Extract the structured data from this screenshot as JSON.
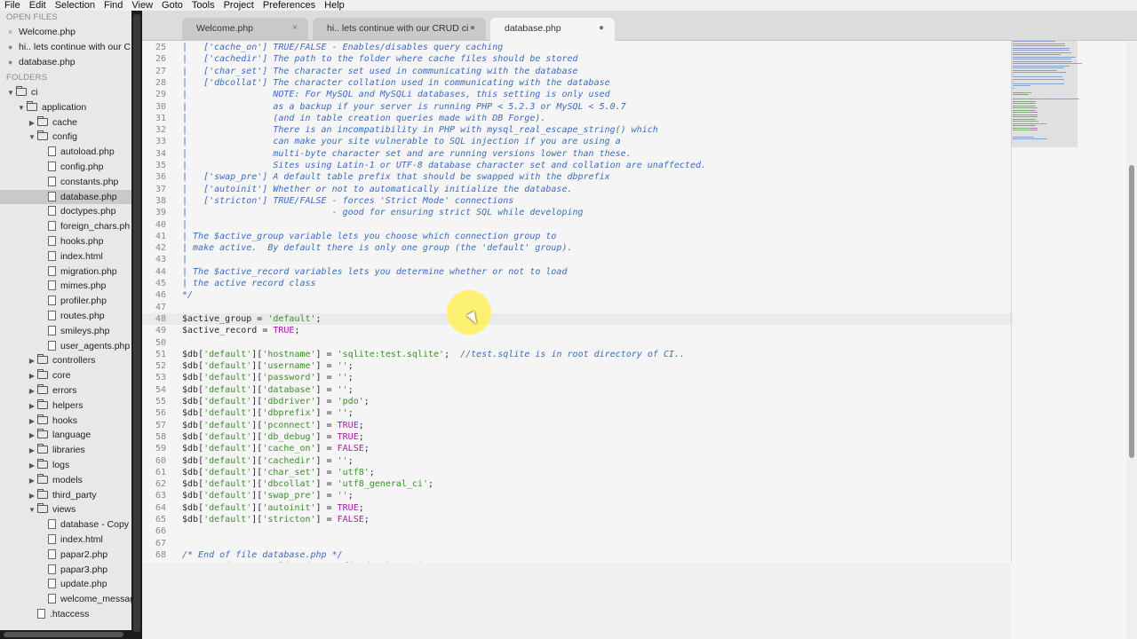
{
  "menu": [
    "File",
    "Edit",
    "Selection",
    "Find",
    "View",
    "Goto",
    "Tools",
    "Project",
    "Preferences",
    "Help"
  ],
  "sidebar": {
    "open_files_header": "OPEN FILES",
    "open_files": [
      {
        "label": "Welcome.php",
        "mark": "×"
      },
      {
        "label": "hi.. lets continue with our C",
        "mark": "●"
      },
      {
        "label": "database.php",
        "mark": "●"
      }
    ],
    "folders_header": "FOLDERS",
    "tree": [
      {
        "label": "ci",
        "type": "folder",
        "depth": 0,
        "state": "open"
      },
      {
        "label": "application",
        "type": "folder",
        "depth": 1,
        "state": "open"
      },
      {
        "label": "cache",
        "type": "folder",
        "depth": 2,
        "state": "closed"
      },
      {
        "label": "config",
        "type": "folder",
        "depth": 2,
        "state": "open"
      },
      {
        "label": "autoload.php",
        "type": "file",
        "depth": 3
      },
      {
        "label": "config.php",
        "type": "file",
        "depth": 3
      },
      {
        "label": "constants.php",
        "type": "file",
        "depth": 3
      },
      {
        "label": "database.php",
        "type": "file",
        "depth": 3,
        "selected": true
      },
      {
        "label": "doctypes.php",
        "type": "file",
        "depth": 3
      },
      {
        "label": "foreign_chars.ph",
        "type": "file",
        "depth": 3
      },
      {
        "label": "hooks.php",
        "type": "file",
        "depth": 3
      },
      {
        "label": "index.html",
        "type": "file",
        "depth": 3
      },
      {
        "label": "migration.php",
        "type": "file",
        "depth": 3
      },
      {
        "label": "mimes.php",
        "type": "file",
        "depth": 3
      },
      {
        "label": "profiler.php",
        "type": "file",
        "depth": 3
      },
      {
        "label": "routes.php",
        "type": "file",
        "depth": 3
      },
      {
        "label": "smileys.php",
        "type": "file",
        "depth": 3
      },
      {
        "label": "user_agents.php",
        "type": "file",
        "depth": 3
      },
      {
        "label": "controllers",
        "type": "folder",
        "depth": 2,
        "state": "closed"
      },
      {
        "label": "core",
        "type": "folder",
        "depth": 2,
        "state": "closed"
      },
      {
        "label": "errors",
        "type": "folder",
        "depth": 2,
        "state": "closed"
      },
      {
        "label": "helpers",
        "type": "folder",
        "depth": 2,
        "state": "closed"
      },
      {
        "label": "hooks",
        "type": "folder",
        "depth": 2,
        "state": "closed"
      },
      {
        "label": "language",
        "type": "folder",
        "depth": 2,
        "state": "closed"
      },
      {
        "label": "libraries",
        "type": "folder",
        "depth": 2,
        "state": "closed"
      },
      {
        "label": "logs",
        "type": "folder",
        "depth": 2,
        "state": "closed"
      },
      {
        "label": "models",
        "type": "folder",
        "depth": 2,
        "state": "closed"
      },
      {
        "label": "third_party",
        "type": "folder",
        "depth": 2,
        "state": "closed"
      },
      {
        "label": "views",
        "type": "folder",
        "depth": 2,
        "state": "open"
      },
      {
        "label": "database - Copy",
        "type": "file",
        "depth": 3
      },
      {
        "label": "index.html",
        "type": "file",
        "depth": 3
      },
      {
        "label": "papar2.php",
        "type": "file",
        "depth": 3
      },
      {
        "label": "papar3.php",
        "type": "file",
        "depth": 3
      },
      {
        "label": "update.php",
        "type": "file",
        "depth": 3
      },
      {
        "label": "welcome_messag",
        "type": "file",
        "depth": 3
      },
      {
        "label": ".htaccess",
        "type": "file",
        "depth": 2
      }
    ]
  },
  "tabs": [
    {
      "label": "Welcome.php",
      "mark": "×",
      "active": false
    },
    {
      "label": "hi.. lets continue with our CRUD ci",
      "mark": "●",
      "active": false
    },
    {
      "label": "database.php",
      "mark": "●",
      "active": true
    }
  ],
  "editor": {
    "first_line": 25,
    "highlighted_line": 48,
    "lines": [
      [
        [
          "cm",
          "|   ['cache_on'] TRUE/FALSE - Enables/disables query caching"
        ]
      ],
      [
        [
          "cm",
          "|   ['cachedir'] The path to the folder where cache files should be stored"
        ]
      ],
      [
        [
          "cm",
          "|   ['char_set'] The character set used in communicating with the database"
        ]
      ],
      [
        [
          "cm",
          "|   ['dbcollat'] The character collation used in communicating with the database"
        ]
      ],
      [
        [
          "cm",
          "|                NOTE: For MySQL and MySQLi databases, this setting is only used"
        ]
      ],
      [
        [
          "cm",
          "|                as a backup if your server is running PHP < 5.2.3 or MySQL < 5.0.7"
        ]
      ],
      [
        [
          "cm",
          "|                (and in table creation queries made with DB Forge)."
        ]
      ],
      [
        [
          "cm",
          "|                There is an incompatibility in PHP with mysql_real_escape_string() which"
        ]
      ],
      [
        [
          "cm",
          "|                can make your site vulnerable to SQL injection if you are using a"
        ]
      ],
      [
        [
          "cm",
          "|                multi-byte character set and are running versions lower than these."
        ]
      ],
      [
        [
          "cm",
          "|                Sites using Latin-1 or UTF-8 database character set and collation are unaffected."
        ]
      ],
      [
        [
          "cm",
          "|   ['swap_pre'] A default table prefix that should be swapped with the dbprefix"
        ]
      ],
      [
        [
          "cm",
          "|   ['autoinit'] Whether or not to automatically initialize the database."
        ]
      ],
      [
        [
          "cm",
          "|   ['stricton'] TRUE/FALSE - forces 'Strict Mode' connections"
        ]
      ],
      [
        [
          "cm",
          "|                           - good for ensuring strict SQL while developing"
        ]
      ],
      [
        [
          "cm",
          "|"
        ]
      ],
      [
        [
          "cm",
          "| The $active_group variable lets you choose which connection group to"
        ]
      ],
      [
        [
          "cm",
          "| make active.  By default there is only one group (the 'default' group)."
        ]
      ],
      [
        [
          "cm",
          "|"
        ]
      ],
      [
        [
          "cm",
          "| The $active_record variables lets you determine whether or not to load"
        ]
      ],
      [
        [
          "cm",
          "| the active record class"
        ]
      ],
      [
        [
          "cm",
          "*/"
        ]
      ],
      [
        [
          "op",
          ""
        ]
      ],
      [
        [
          "vr",
          "$active_group"
        ],
        [
          "op",
          " = "
        ],
        [
          "st",
          "'default'"
        ],
        [
          "op",
          ";"
        ]
      ],
      [
        [
          "vr",
          "$active_record"
        ],
        [
          "op",
          " = "
        ],
        [
          "kw",
          "TRUE"
        ],
        [
          "op",
          ";"
        ]
      ],
      [
        [
          "op",
          ""
        ]
      ],
      [
        [
          "vr",
          "$db"
        ],
        [
          "op",
          "["
        ],
        [
          "st",
          "'default'"
        ],
        [
          "op",
          "]["
        ],
        [
          "st",
          "'hostname'"
        ],
        [
          "op",
          "] = "
        ],
        [
          "st",
          "'sqlite:test.sqlite'"
        ],
        [
          "op",
          ";  "
        ],
        [
          "cm",
          "//test.sqlite is in root directory of CI.."
        ]
      ],
      [
        [
          "vr",
          "$db"
        ],
        [
          "op",
          "["
        ],
        [
          "st",
          "'default'"
        ],
        [
          "op",
          "]["
        ],
        [
          "st",
          "'username'"
        ],
        [
          "op",
          "] = "
        ],
        [
          "st",
          "''"
        ],
        [
          "op",
          ";"
        ]
      ],
      [
        [
          "vr",
          "$db"
        ],
        [
          "op",
          "["
        ],
        [
          "st",
          "'default'"
        ],
        [
          "op",
          "]["
        ],
        [
          "st",
          "'password'"
        ],
        [
          "op",
          "] = "
        ],
        [
          "st",
          "''"
        ],
        [
          "op",
          ";"
        ]
      ],
      [
        [
          "vr",
          "$db"
        ],
        [
          "op",
          "["
        ],
        [
          "st",
          "'default'"
        ],
        [
          "op",
          "]["
        ],
        [
          "st",
          "'database'"
        ],
        [
          "op",
          "] = "
        ],
        [
          "st",
          "''"
        ],
        [
          "op",
          ";"
        ]
      ],
      [
        [
          "vr",
          "$db"
        ],
        [
          "op",
          "["
        ],
        [
          "st",
          "'default'"
        ],
        [
          "op",
          "]["
        ],
        [
          "st",
          "'dbdriver'"
        ],
        [
          "op",
          "] = "
        ],
        [
          "st",
          "'pdo'"
        ],
        [
          "op",
          ";"
        ]
      ],
      [
        [
          "vr",
          "$db"
        ],
        [
          "op",
          "["
        ],
        [
          "st",
          "'default'"
        ],
        [
          "op",
          "]["
        ],
        [
          "st",
          "'dbprefix'"
        ],
        [
          "op",
          "] = "
        ],
        [
          "st",
          "''"
        ],
        [
          "op",
          ";"
        ]
      ],
      [
        [
          "vr",
          "$db"
        ],
        [
          "op",
          "["
        ],
        [
          "st",
          "'default'"
        ],
        [
          "op",
          "]["
        ],
        [
          "st",
          "'pconnect'"
        ],
        [
          "op",
          "] = "
        ],
        [
          "kw",
          "TRUE"
        ],
        [
          "op",
          ";"
        ]
      ],
      [
        [
          "vr",
          "$db"
        ],
        [
          "op",
          "["
        ],
        [
          "st",
          "'default'"
        ],
        [
          "op",
          "]["
        ],
        [
          "st",
          "'db_debug'"
        ],
        [
          "op",
          "] = "
        ],
        [
          "kw",
          "TRUE"
        ],
        [
          "op",
          ";"
        ]
      ],
      [
        [
          "vr",
          "$db"
        ],
        [
          "op",
          "["
        ],
        [
          "st",
          "'default'"
        ],
        [
          "op",
          "]["
        ],
        [
          "st",
          "'cache_on'"
        ],
        [
          "op",
          "] = "
        ],
        [
          "kw",
          "FALSE"
        ],
        [
          "op",
          ";"
        ]
      ],
      [
        [
          "vr",
          "$db"
        ],
        [
          "op",
          "["
        ],
        [
          "st",
          "'default'"
        ],
        [
          "op",
          "]["
        ],
        [
          "st",
          "'cachedir'"
        ],
        [
          "op",
          "] = "
        ],
        [
          "st",
          "''"
        ],
        [
          "op",
          ";"
        ]
      ],
      [
        [
          "vr",
          "$db"
        ],
        [
          "op",
          "["
        ],
        [
          "st",
          "'default'"
        ],
        [
          "op",
          "]["
        ],
        [
          "st",
          "'char_set'"
        ],
        [
          "op",
          "] = "
        ],
        [
          "st",
          "'utf8'"
        ],
        [
          "op",
          ";"
        ]
      ],
      [
        [
          "vr",
          "$db"
        ],
        [
          "op",
          "["
        ],
        [
          "st",
          "'default'"
        ],
        [
          "op",
          "]["
        ],
        [
          "st",
          "'dbcollat'"
        ],
        [
          "op",
          "] = "
        ],
        [
          "st",
          "'utf8_general_ci'"
        ],
        [
          "op",
          ";"
        ]
      ],
      [
        [
          "vr",
          "$db"
        ],
        [
          "op",
          "["
        ],
        [
          "st",
          "'default'"
        ],
        [
          "op",
          "]["
        ],
        [
          "st",
          "'swap_pre'"
        ],
        [
          "op",
          "] = "
        ],
        [
          "st",
          "''"
        ],
        [
          "op",
          ";"
        ]
      ],
      [
        [
          "vr",
          "$db"
        ],
        [
          "op",
          "["
        ],
        [
          "st",
          "'default'"
        ],
        [
          "op",
          "]["
        ],
        [
          "st",
          "'autoinit'"
        ],
        [
          "op",
          "] = "
        ],
        [
          "kw",
          "TRUE"
        ],
        [
          "op",
          ";"
        ]
      ],
      [
        [
          "vr",
          "$db"
        ],
        [
          "op",
          "["
        ],
        [
          "st",
          "'default'"
        ],
        [
          "op",
          "]["
        ],
        [
          "st",
          "'stricton'"
        ],
        [
          "op",
          "] = "
        ],
        [
          "kw",
          "FALSE"
        ],
        [
          "op",
          ";"
        ]
      ],
      [
        [
          "op",
          ""
        ]
      ],
      [
        [
          "op",
          ""
        ]
      ],
      [
        [
          "cm",
          "/* End of file database.php */"
        ]
      ],
      [
        [
          "cm",
          "/* Location: ./application/config/database.php */"
        ]
      ]
    ]
  },
  "colors": {
    "comment": "#3b6cbf",
    "string": "#3b8e2c",
    "keyword": "#a020a0",
    "text": "#2a2a2a",
    "cursor_highlight": "#fff050"
  }
}
